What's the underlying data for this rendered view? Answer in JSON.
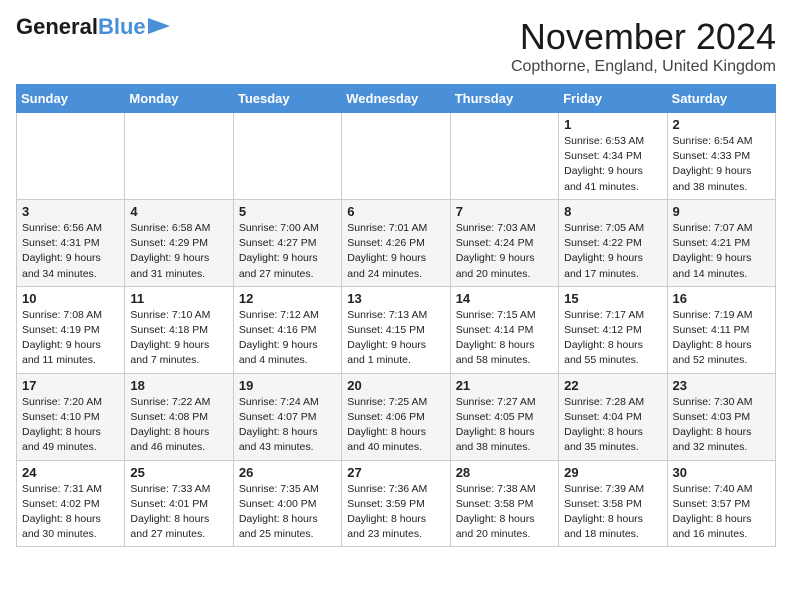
{
  "header": {
    "logo_general": "General",
    "logo_blue": "Blue",
    "month_title": "November 2024",
    "location": "Copthorne, England, United Kingdom"
  },
  "days_of_week": [
    "Sunday",
    "Monday",
    "Tuesday",
    "Wednesday",
    "Thursday",
    "Friday",
    "Saturday"
  ],
  "weeks": [
    [
      {
        "day": "",
        "info": ""
      },
      {
        "day": "",
        "info": ""
      },
      {
        "day": "",
        "info": ""
      },
      {
        "day": "",
        "info": ""
      },
      {
        "day": "",
        "info": ""
      },
      {
        "day": "1",
        "info": "Sunrise: 6:53 AM\nSunset: 4:34 PM\nDaylight: 9 hours and 41 minutes."
      },
      {
        "day": "2",
        "info": "Sunrise: 6:54 AM\nSunset: 4:33 PM\nDaylight: 9 hours and 38 minutes."
      }
    ],
    [
      {
        "day": "3",
        "info": "Sunrise: 6:56 AM\nSunset: 4:31 PM\nDaylight: 9 hours and 34 minutes."
      },
      {
        "day": "4",
        "info": "Sunrise: 6:58 AM\nSunset: 4:29 PM\nDaylight: 9 hours and 31 minutes."
      },
      {
        "day": "5",
        "info": "Sunrise: 7:00 AM\nSunset: 4:27 PM\nDaylight: 9 hours and 27 minutes."
      },
      {
        "day": "6",
        "info": "Sunrise: 7:01 AM\nSunset: 4:26 PM\nDaylight: 9 hours and 24 minutes."
      },
      {
        "day": "7",
        "info": "Sunrise: 7:03 AM\nSunset: 4:24 PM\nDaylight: 9 hours and 20 minutes."
      },
      {
        "day": "8",
        "info": "Sunrise: 7:05 AM\nSunset: 4:22 PM\nDaylight: 9 hours and 17 minutes."
      },
      {
        "day": "9",
        "info": "Sunrise: 7:07 AM\nSunset: 4:21 PM\nDaylight: 9 hours and 14 minutes."
      }
    ],
    [
      {
        "day": "10",
        "info": "Sunrise: 7:08 AM\nSunset: 4:19 PM\nDaylight: 9 hours and 11 minutes."
      },
      {
        "day": "11",
        "info": "Sunrise: 7:10 AM\nSunset: 4:18 PM\nDaylight: 9 hours and 7 minutes."
      },
      {
        "day": "12",
        "info": "Sunrise: 7:12 AM\nSunset: 4:16 PM\nDaylight: 9 hours and 4 minutes."
      },
      {
        "day": "13",
        "info": "Sunrise: 7:13 AM\nSunset: 4:15 PM\nDaylight: 9 hours and 1 minute."
      },
      {
        "day": "14",
        "info": "Sunrise: 7:15 AM\nSunset: 4:14 PM\nDaylight: 8 hours and 58 minutes."
      },
      {
        "day": "15",
        "info": "Sunrise: 7:17 AM\nSunset: 4:12 PM\nDaylight: 8 hours and 55 minutes."
      },
      {
        "day": "16",
        "info": "Sunrise: 7:19 AM\nSunset: 4:11 PM\nDaylight: 8 hours and 52 minutes."
      }
    ],
    [
      {
        "day": "17",
        "info": "Sunrise: 7:20 AM\nSunset: 4:10 PM\nDaylight: 8 hours and 49 minutes."
      },
      {
        "day": "18",
        "info": "Sunrise: 7:22 AM\nSunset: 4:08 PM\nDaylight: 8 hours and 46 minutes."
      },
      {
        "day": "19",
        "info": "Sunrise: 7:24 AM\nSunset: 4:07 PM\nDaylight: 8 hours and 43 minutes."
      },
      {
        "day": "20",
        "info": "Sunrise: 7:25 AM\nSunset: 4:06 PM\nDaylight: 8 hours and 40 minutes."
      },
      {
        "day": "21",
        "info": "Sunrise: 7:27 AM\nSunset: 4:05 PM\nDaylight: 8 hours and 38 minutes."
      },
      {
        "day": "22",
        "info": "Sunrise: 7:28 AM\nSunset: 4:04 PM\nDaylight: 8 hours and 35 minutes."
      },
      {
        "day": "23",
        "info": "Sunrise: 7:30 AM\nSunset: 4:03 PM\nDaylight: 8 hours and 32 minutes."
      }
    ],
    [
      {
        "day": "24",
        "info": "Sunrise: 7:31 AM\nSunset: 4:02 PM\nDaylight: 8 hours and 30 minutes."
      },
      {
        "day": "25",
        "info": "Sunrise: 7:33 AM\nSunset: 4:01 PM\nDaylight: 8 hours and 27 minutes."
      },
      {
        "day": "26",
        "info": "Sunrise: 7:35 AM\nSunset: 4:00 PM\nDaylight: 8 hours and 25 minutes."
      },
      {
        "day": "27",
        "info": "Sunrise: 7:36 AM\nSunset: 3:59 PM\nDaylight: 8 hours and 23 minutes."
      },
      {
        "day": "28",
        "info": "Sunrise: 7:38 AM\nSunset: 3:58 PM\nDaylight: 8 hours and 20 minutes."
      },
      {
        "day": "29",
        "info": "Sunrise: 7:39 AM\nSunset: 3:58 PM\nDaylight: 8 hours and 18 minutes."
      },
      {
        "day": "30",
        "info": "Sunrise: 7:40 AM\nSunset: 3:57 PM\nDaylight: 8 hours and 16 minutes."
      }
    ]
  ]
}
